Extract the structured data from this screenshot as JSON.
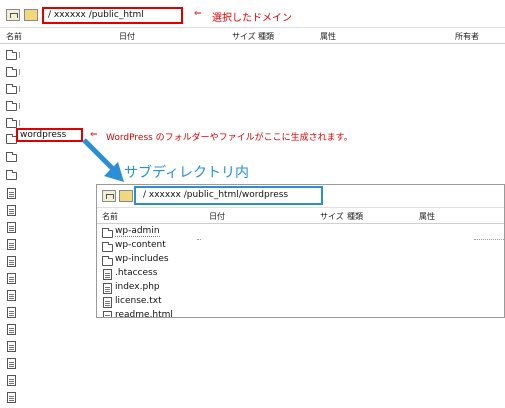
{
  "main": {
    "path": "/  xxxxxx  /public_html",
    "selected_domain_note": "選択したドメイン",
    "columns": {
      "name": "名前",
      "date": "日付",
      "size": "サイズ",
      "type": "種類",
      "attr": "属性",
      "owner": "所有者"
    },
    "highlighted_item": "wordpress",
    "wordpress_note": "WordPress のフォルダーやファイルがここに生成されます。"
  },
  "overlay": {
    "caption": "サブディレクトリ内",
    "path": "/   xxxxxx  /public_html/wordpress",
    "columns": {
      "name": "名前",
      "date": "日付",
      "size": "サイズ",
      "type": "種類",
      "attr": "属性"
    },
    "items": [
      {
        "name": "wp-admin",
        "icon": "folder-icon"
      },
      {
        "name": "wp-content",
        "icon": "folder-icon"
      },
      {
        "name": "wp-includes",
        "icon": "folder-icon"
      },
      {
        "name": ".htaccess",
        "icon": "file-icon"
      },
      {
        "name": "index.php",
        "icon": "file-icon"
      },
      {
        "name": "license.txt",
        "icon": "file-icon"
      },
      {
        "name": "readme.html",
        "icon": "file-icon"
      }
    ]
  },
  "colors": {
    "annotation_red": "#e00000",
    "annotation_blue": "#2a8fd8"
  }
}
